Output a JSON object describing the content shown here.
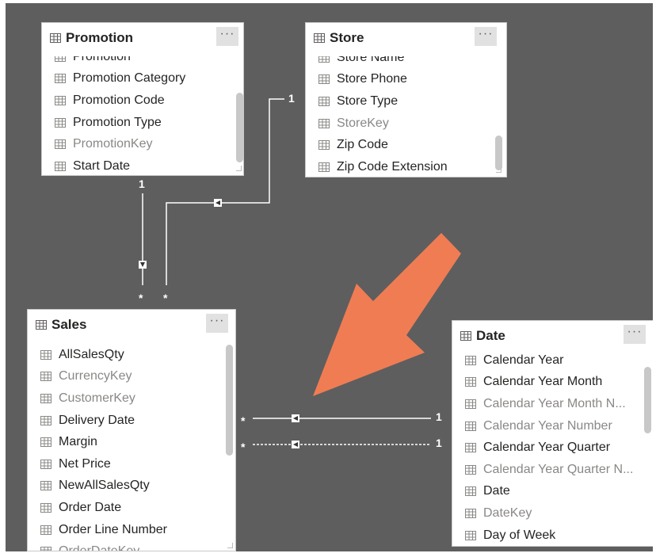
{
  "tables": {
    "promotion": {
      "name": "Promotion",
      "more_label": "···",
      "fields": [
        {
          "label": "Promotion",
          "hidden": false
        },
        {
          "label": "Promotion Category",
          "hidden": false
        },
        {
          "label": "Promotion Code",
          "hidden": false
        },
        {
          "label": "Promotion Type",
          "hidden": false
        },
        {
          "label": "PromotionKey",
          "hidden": true
        },
        {
          "label": "Start Date",
          "hidden": false
        }
      ]
    },
    "store": {
      "name": "Store",
      "more_label": "···",
      "fields": [
        {
          "label": "Store Name",
          "hidden": false
        },
        {
          "label": "Store Phone",
          "hidden": false
        },
        {
          "label": "Store Type",
          "hidden": false
        },
        {
          "label": "StoreKey",
          "hidden": true
        },
        {
          "label": "Zip Code",
          "hidden": false
        },
        {
          "label": "Zip Code Extension",
          "hidden": false
        }
      ]
    },
    "sales": {
      "name": "Sales",
      "more_label": "···",
      "fields": [
        {
          "label": "AllSalesQty",
          "hidden": false
        },
        {
          "label": "CurrencyKey",
          "hidden": true
        },
        {
          "label": "CustomerKey",
          "hidden": true
        },
        {
          "label": "Delivery Date",
          "hidden": false
        },
        {
          "label": "Margin",
          "hidden": false
        },
        {
          "label": "Net Price",
          "hidden": false
        },
        {
          "label": "NewAllSalesQty",
          "hidden": false
        },
        {
          "label": "Order Date",
          "hidden": false
        },
        {
          "label": "Order Line Number",
          "hidden": false
        },
        {
          "label": "OrderDateKey",
          "hidden": true
        }
      ]
    },
    "date": {
      "name": "Date",
      "more_label": "···",
      "fields": [
        {
          "label": "Calendar Year",
          "hidden": false
        },
        {
          "label": "Calendar Year Month",
          "hidden": false
        },
        {
          "label": "Calendar Year Month N...",
          "hidden": true
        },
        {
          "label": "Calendar Year Number",
          "hidden": true
        },
        {
          "label": "Calendar Year Quarter",
          "hidden": false
        },
        {
          "label": "Calendar Year Quarter N...",
          "hidden": true
        },
        {
          "label": "Date",
          "hidden": false
        },
        {
          "label": "DateKey",
          "hidden": true
        },
        {
          "label": "Day of Week",
          "hidden": false
        }
      ]
    }
  },
  "relationships": {
    "promotion_sales": {
      "one": "1",
      "many": "*",
      "active": true
    },
    "store_sales": {
      "one": "1",
      "many": "*",
      "active": true
    },
    "date_sales_active": {
      "one": "1",
      "many": "*",
      "active": true
    },
    "date_sales_inactive": {
      "one": "1",
      "many": "*",
      "active": false
    }
  },
  "annotation": {
    "arrow_color": "#f07c54",
    "icon": "arrow-annotation-icon"
  },
  "colors": {
    "canvas": "#5e5e5e",
    "card": "#ffffff",
    "field_text": "#252423",
    "hidden_field_text": "#8a8886",
    "relationship_line": "#ffffff"
  }
}
